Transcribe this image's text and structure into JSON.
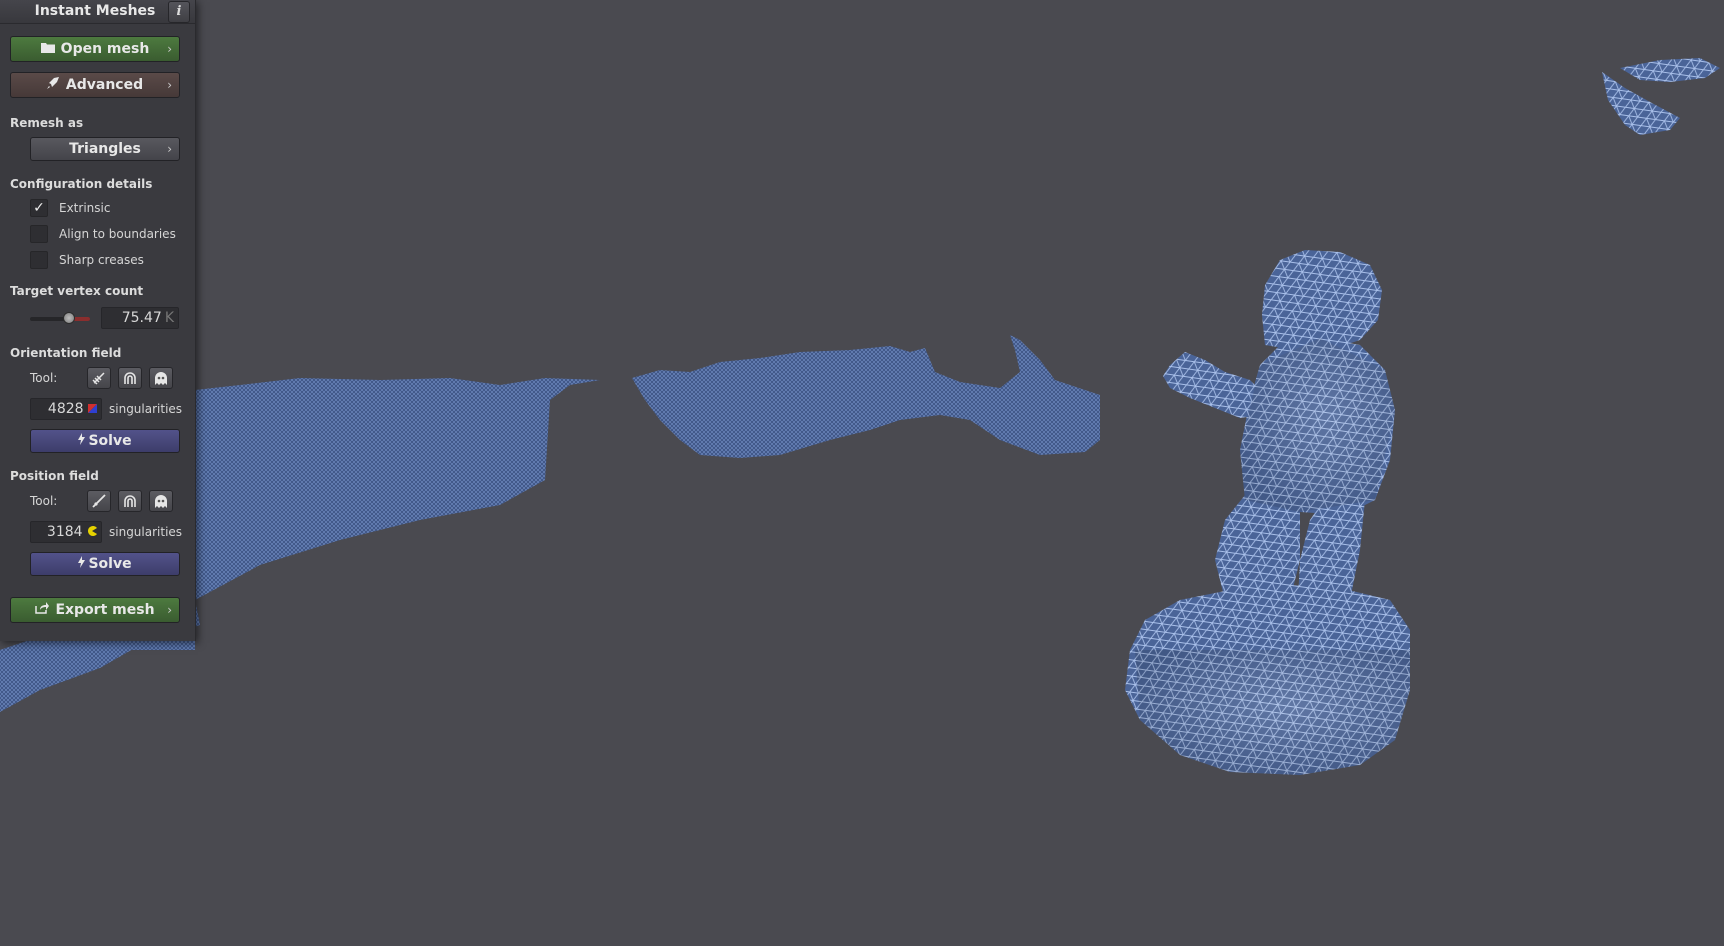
{
  "app": {
    "title": "Instant Meshes",
    "info_label": "i"
  },
  "buttons": {
    "open_mesh": "Open mesh",
    "advanced": "Advanced",
    "export_mesh": "Export mesh",
    "chevron": "›"
  },
  "remesh": {
    "label": "Remesh as",
    "value": "Triangles"
  },
  "config": {
    "label": "Configuration details",
    "options": [
      {
        "label": "Extrinsic",
        "checked": true,
        "mark": "✓"
      },
      {
        "label": "Align to boundaries",
        "checked": false,
        "mark": ""
      },
      {
        "label": "Sharp creases",
        "checked": false,
        "mark": ""
      }
    ]
  },
  "target": {
    "label": "Target vertex count",
    "value": "75.47",
    "unit": "K",
    "slider_fraction": 0.65
  },
  "orientation": {
    "label": "Orientation field",
    "tool_label": "Tool:",
    "tools": [
      "comb-icon",
      "attractor-icon",
      "ghost-icon"
    ],
    "singularities": "4828",
    "singularities_label": "singularities",
    "solve": "Solve"
  },
  "position": {
    "label": "Position field",
    "tool_label": "Tool:",
    "tools": [
      "brush-icon",
      "attractor-icon",
      "ghost-icon"
    ],
    "singularities": "3184",
    "singularities_label": "singularities",
    "solve": "Solve"
  },
  "colors": {
    "background": "#4a4a50",
    "panel": "#3a3a3f",
    "mesh": "#4f6a9e",
    "green_button": "#4d7a3f",
    "solve_button": "#52528a"
  }
}
